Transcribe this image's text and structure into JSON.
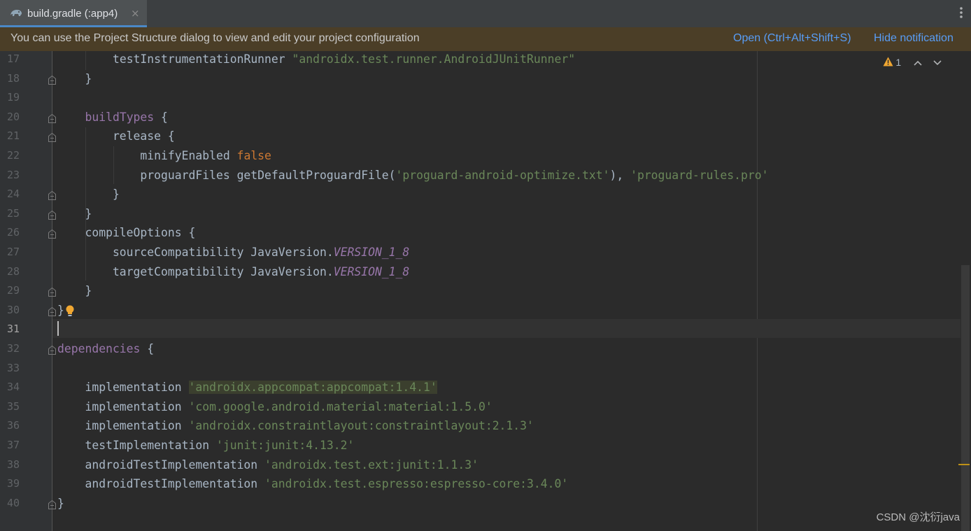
{
  "tab": {
    "title": "build.gradle (:app4)",
    "close": "×"
  },
  "notification": {
    "message": "You can use the Project Structure dialog to view and edit your project configuration",
    "open_link": "Open (Ctrl+Alt+Shift+S)",
    "hide_link": "Hide notification"
  },
  "inspection": {
    "warning_count": "1"
  },
  "colors": {
    "accent": "#4a88c7",
    "warning": "#f0a732",
    "link": "#589df6"
  },
  "editor": {
    "current_line": "31",
    "lines": [
      {
        "n": "17",
        "t": [
          [
            "        ",
            "k-plain"
          ],
          [
            "testInstrumentationRunner ",
            "k-dsl"
          ],
          [
            "\"androidx.test.runner.AndroidJUnitRunner\"",
            "k-str"
          ]
        ]
      },
      {
        "n": "18",
        "t": [
          [
            "    }",
            "k-plain"
          ]
        ]
      },
      {
        "n": "19",
        "t": []
      },
      {
        "n": "20",
        "t": [
          [
            "    ",
            "k-plain"
          ],
          [
            "buildTypes",
            "k-purple"
          ],
          [
            " {",
            "k-plain"
          ]
        ]
      },
      {
        "n": "21",
        "t": [
          [
            "        release {",
            "k-plain"
          ]
        ]
      },
      {
        "n": "22",
        "t": [
          [
            "            minifyEnabled ",
            "k-plain"
          ],
          [
            "false",
            "k-kw"
          ]
        ]
      },
      {
        "n": "23",
        "t": [
          [
            "            proguardFiles getDefaultProguardFile(",
            "k-plain"
          ],
          [
            "'proguard-android-optimize.txt'",
            "k-str"
          ],
          [
            "), ",
            "k-plain"
          ],
          [
            "'proguard-rules.pro'",
            "k-str"
          ]
        ]
      },
      {
        "n": "24",
        "t": [
          [
            "        }",
            "k-plain"
          ]
        ]
      },
      {
        "n": "25",
        "t": [
          [
            "    }",
            "k-plain"
          ]
        ]
      },
      {
        "n": "26",
        "t": [
          [
            "    compileOptions {",
            "k-plain"
          ]
        ]
      },
      {
        "n": "27",
        "t": [
          [
            "        sourceCompatibility JavaVersion.",
            "k-plain"
          ],
          [
            "VERSION_1_8",
            "k-const"
          ]
        ]
      },
      {
        "n": "28",
        "t": [
          [
            "        targetCompatibility JavaVersion.",
            "k-plain"
          ],
          [
            "VERSION_1_8",
            "k-const"
          ]
        ]
      },
      {
        "n": "29",
        "t": [
          [
            "    }",
            "k-plain"
          ]
        ]
      },
      {
        "n": "30",
        "t": [
          [
            "}",
            "k-plain"
          ]
        ]
      },
      {
        "n": "31",
        "t": []
      },
      {
        "n": "32",
        "t": [
          [
            "dependencies",
            "k-purple"
          ],
          [
            " {",
            "k-plain"
          ]
        ]
      },
      {
        "n": "33",
        "t": []
      },
      {
        "n": "34",
        "t": [
          [
            "    implementation ",
            "k-plain"
          ],
          [
            "'androidx.appcompat:appcompat:1.4.1'",
            "k-str hl"
          ]
        ]
      },
      {
        "n": "35",
        "t": [
          [
            "    implementation ",
            "k-plain"
          ],
          [
            "'com.google.android.material:material:1.5.0'",
            "k-str"
          ]
        ]
      },
      {
        "n": "36",
        "t": [
          [
            "    implementation ",
            "k-plain"
          ],
          [
            "'androidx.constraintlayout:constraintlayout:2.1.3'",
            "k-str"
          ]
        ]
      },
      {
        "n": "37",
        "t": [
          [
            "    testImplementation ",
            "k-plain"
          ],
          [
            "'junit:junit:4.13.2'",
            "k-str"
          ]
        ]
      },
      {
        "n": "38",
        "t": [
          [
            "    androidTestImplementation ",
            "k-plain"
          ],
          [
            "'androidx.test.ext:junit:1.1.3'",
            "k-str"
          ]
        ]
      },
      {
        "n": "39",
        "t": [
          [
            "    androidTestImplementation ",
            "k-plain"
          ],
          [
            "'androidx.test.espresso:espresso-core:3.4.0'",
            "k-str"
          ]
        ]
      },
      {
        "n": "40",
        "t": [
          [
            "}",
            "k-plain"
          ]
        ]
      }
    ],
    "fold_lines": [
      "18",
      "20",
      "21",
      "24",
      "25",
      "26",
      "29",
      "30",
      "32",
      "40"
    ]
  },
  "watermark": "CSDN @沈衍java"
}
